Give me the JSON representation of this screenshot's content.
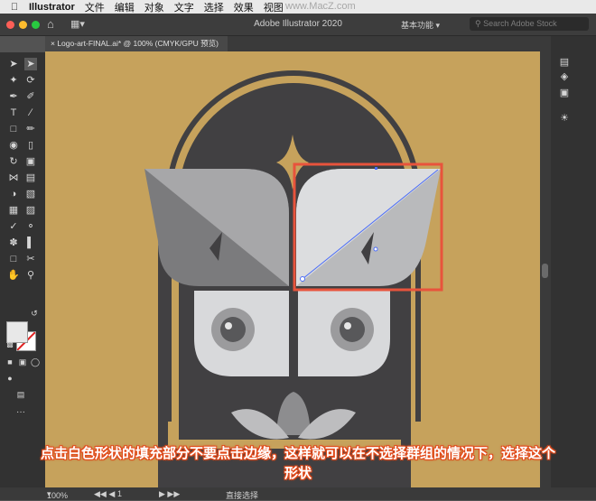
{
  "menubar": {
    "app": "Illustrator",
    "items": [
      "文件",
      "编辑",
      "对象",
      "文字",
      "选择",
      "效果",
      "视图"
    ]
  },
  "watermark": "www.MacZ.com",
  "titlebar": {
    "title": "Adobe Illustrator 2020",
    "workspace": "基本功能",
    "search_placeholder": "Search Adobe Stock"
  },
  "document": {
    "tab": "Logo-art-FINAL.ai* @ 100% (CMYK/GPU 预览)"
  },
  "statusbar": {
    "zoom": "100%",
    "artboard": "1",
    "tool": "直接选择"
  },
  "caption": {
    "line1": "点击白色形状的填充部分不要点击边缘，这样就可以在不选择群组的情况下，选择这个",
    "line2": "形状"
  },
  "colors": {
    "artboard": "#c6a25c",
    "dark_shape": "#414042",
    "highlight": "#e8533c",
    "selection": "#4a6cf7"
  }
}
